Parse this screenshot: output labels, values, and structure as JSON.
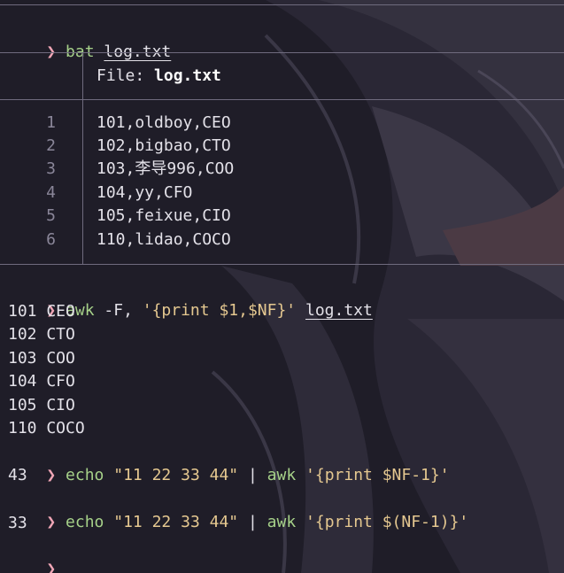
{
  "prompt_symbol": "❯",
  "commands": [
    {
      "cmd": "bat",
      "args": " ",
      "file": "log.txt"
    },
    {
      "cmd": "awk",
      "args": " -F, ",
      "str": "'{print $1,$NF}'",
      "file": "log.txt"
    },
    {
      "cmd": "echo",
      "str1": "\"11 22 33 44\"",
      "pipe": " | ",
      "cmd2": "awk",
      "str2": "'{print $NF-1}'"
    },
    {
      "cmd": "echo",
      "str1": "\"11 22 33 44\"",
      "pipe": " | ",
      "cmd2": "awk",
      "str2": "'{print $(NF-1)}'"
    }
  ],
  "bat": {
    "file_label": "File: ",
    "file_name": "log.txt",
    "lines": [
      {
        "n": "1",
        "text": "101,oldboy,CEO"
      },
      {
        "n": "2",
        "text": "102,bigbao,CTO"
      },
      {
        "n": "3",
        "text": "103,李导996,COO"
      },
      {
        "n": "4",
        "text": "104,yy,CFO"
      },
      {
        "n": "5",
        "text": "105,feixue,CIO"
      },
      {
        "n": "6",
        "text": "110,lidao,COCO"
      }
    ]
  },
  "awk_output": [
    "101 CEO",
    "102 CTO",
    "103 COO",
    "104 CFO",
    "105 CIO",
    "110 COCO"
  ],
  "echo1_output": "43",
  "echo2_output": "33",
  "colors": {
    "background": "#1f1d28",
    "prompt": "#f0a6b6",
    "command": "#a6d189",
    "string": "#e5c890",
    "text": "#e3e1e8",
    "line_number": "#8a8699",
    "rule": "#6f6b7e"
  }
}
